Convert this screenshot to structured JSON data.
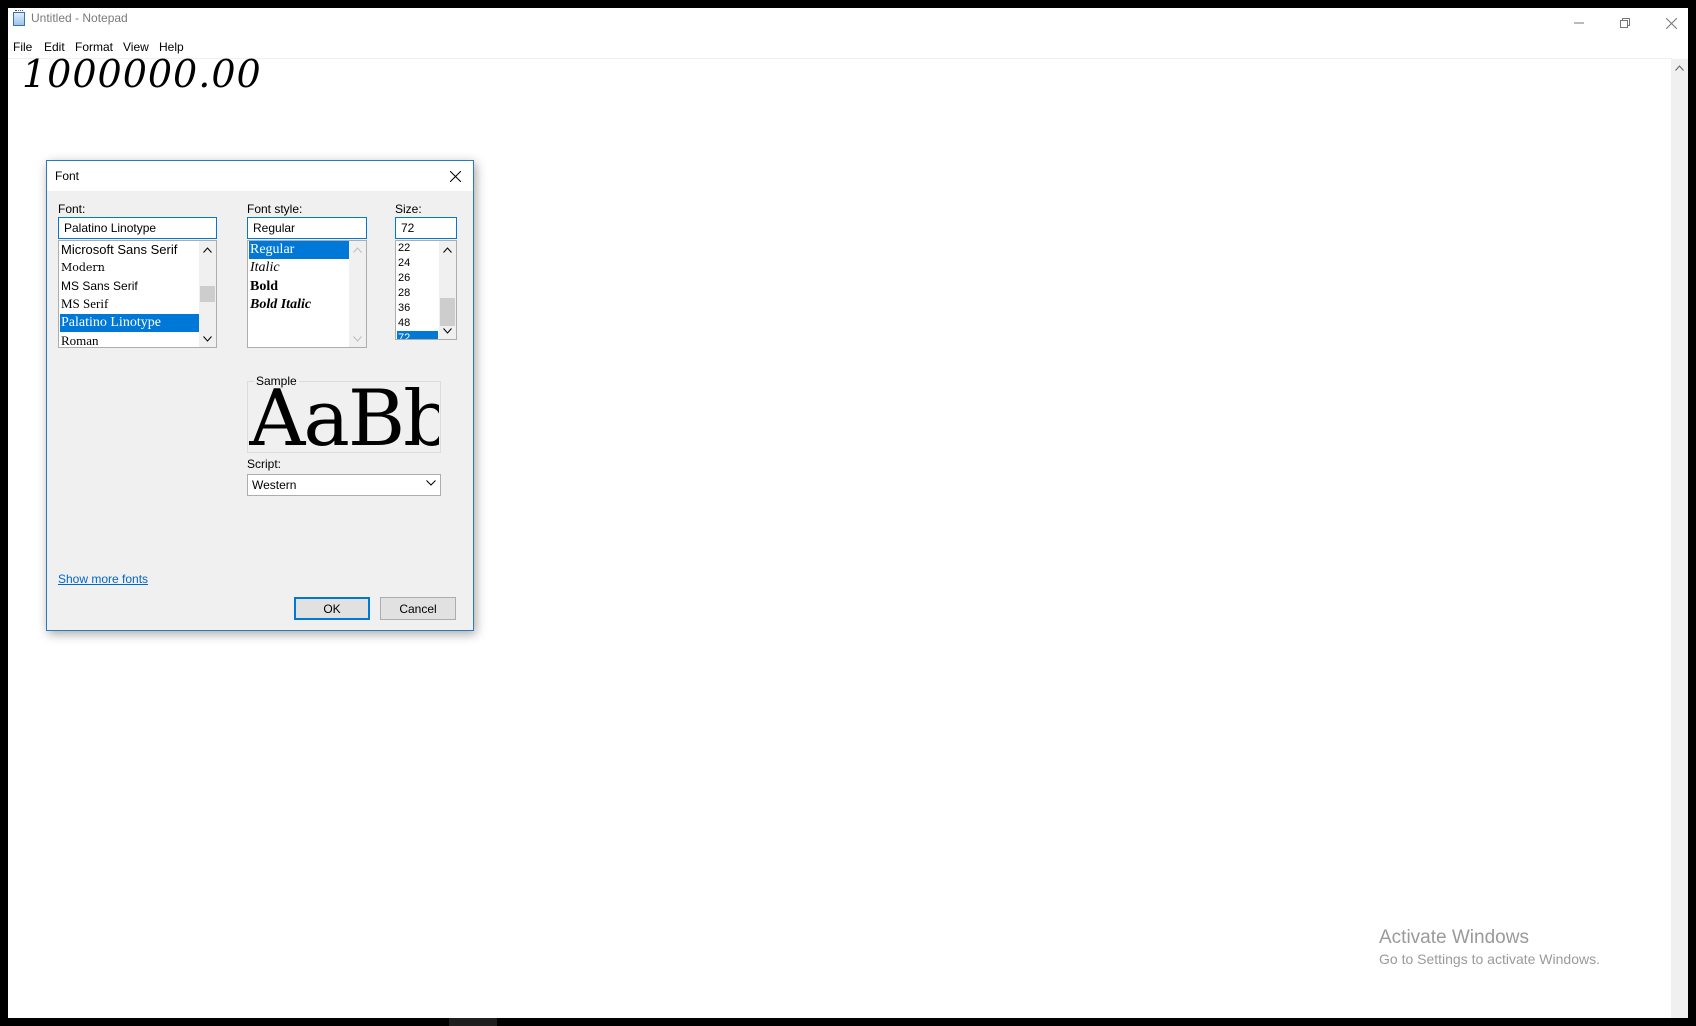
{
  "window": {
    "title": "Untitled - Notepad",
    "menu": [
      "File",
      "Edit",
      "Format",
      "View",
      "Help"
    ]
  },
  "document": {
    "text": "1000000.00"
  },
  "watermark": {
    "title": "Activate Windows",
    "subtitle": "Go to Settings to activate Windows."
  },
  "font_dialog": {
    "title": "Font",
    "font_label": "Font:",
    "font_value": "Palatino Linotype",
    "font_list": [
      "Microsoft Sans Serif",
      "Modern",
      "MS Sans Serif",
      "MS Serif",
      "Palatino Linotype",
      "Roman"
    ],
    "font_selected": "Palatino Linotype",
    "style_label": "Font style:",
    "style_value": "Regular",
    "style_list": [
      "Regular",
      "Italic",
      "Bold",
      "Bold Italic"
    ],
    "style_selected": "Regular",
    "size_label": "Size:",
    "size_value": "72",
    "size_list": [
      "22",
      "24",
      "26",
      "28",
      "36",
      "48",
      "72"
    ],
    "size_selected": "72",
    "sample_label": "Sample",
    "sample_text": "AaBbYyZz",
    "script_label": "Script:",
    "script_value": "Western",
    "show_more_fonts": "Show more fonts",
    "ok_label": "OK",
    "cancel_label": "Cancel"
  },
  "colors": {
    "selection": "#0078d7",
    "dialog_bg": "#f0f0f0",
    "link": "#0066cc",
    "border_accent": "#0078d7"
  },
  "icons": [
    "notepad-icon",
    "minimize-icon",
    "restore-icon",
    "close-icon",
    "chevron-up-icon",
    "chevron-down-icon"
  ]
}
